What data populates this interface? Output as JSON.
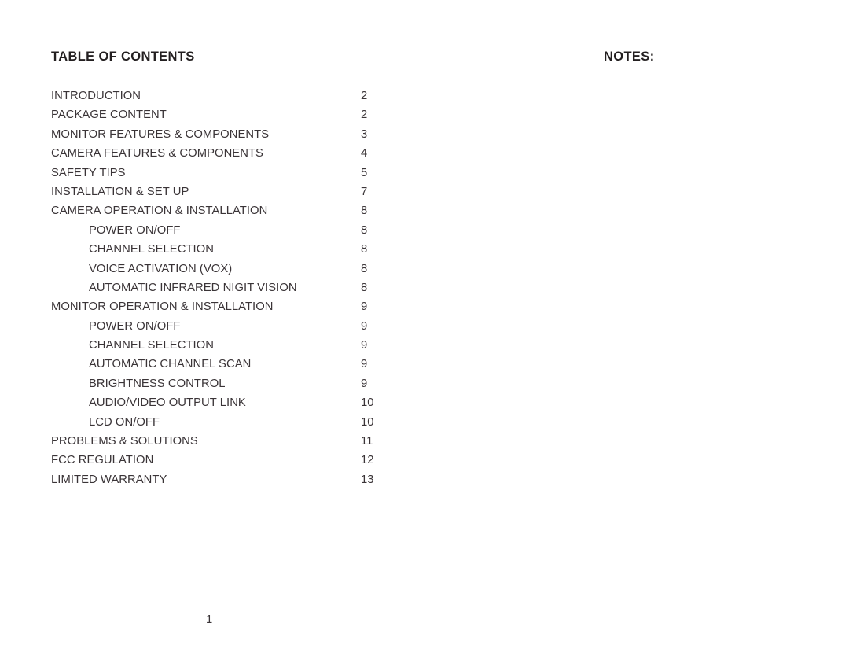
{
  "document": {
    "page_number": "1"
  },
  "headings": {
    "toc": "TABLE OF CONTENTS",
    "notes": "NOTES:"
  },
  "toc": {
    "entries": [
      {
        "label": "INTRODUCTION",
        "page": "2",
        "level": 0
      },
      {
        "label": "PACKAGE CONTENT",
        "page": "2",
        "level": 0
      },
      {
        "label": "MONITOR FEATURES & COMPONENTS",
        "page": "3",
        "level": 0
      },
      {
        "label": "CAMERA FEATURES & COMPONENTS",
        "page": "4",
        "level": 0
      },
      {
        "label": "SAFETY TIPS",
        "page": "5",
        "level": 0
      },
      {
        "label": "INSTALLATION & SET UP",
        "page": "7",
        "level": 0
      },
      {
        "label": "CAMERA OPERATION & INSTALLATION",
        "page": "8",
        "level": 0
      },
      {
        "label": "POWER ON/OFF",
        "page": "8",
        "level": 1
      },
      {
        "label": "CHANNEL SELECTION",
        "page": "8",
        "level": 1
      },
      {
        "label": "VOICE ACTIVATION (VOX)",
        "page": "8",
        "level": 1
      },
      {
        "label": "AUTOMATIC INFRARED NIGIT VISION",
        "page": "8",
        "level": 1
      },
      {
        "label": "MONITOR OPERATION & INSTALLATION",
        "page": "9",
        "level": 0
      },
      {
        "label": "POWER ON/OFF",
        "page": "9",
        "level": 1
      },
      {
        "label": "CHANNEL SELECTION",
        "page": "9",
        "level": 1
      },
      {
        "label": "AUTOMATIC CHANNEL SCAN",
        "page": "9",
        "level": 1
      },
      {
        "label": "BRIGHTNESS CONTROL",
        "page": "9",
        "level": 1
      },
      {
        "label": "AUDIO/VIDEO OUTPUT LINK",
        "page": "10",
        "level": 1
      },
      {
        "label": "LCD ON/OFF",
        "page": "10",
        "level": 1
      },
      {
        "label": "PROBLEMS & SOLUTIONS",
        "page": "11",
        "level": 0
      },
      {
        "label": "FCC REGULATION",
        "page": "12",
        "level": 0
      },
      {
        "label": "LIMITED WARRANTY",
        "page": "13",
        "level": 0
      }
    ]
  },
  "colors": {
    "page_background": "#ffffff",
    "heading_text": "#231f20",
    "body_text": "#3a3437"
  }
}
